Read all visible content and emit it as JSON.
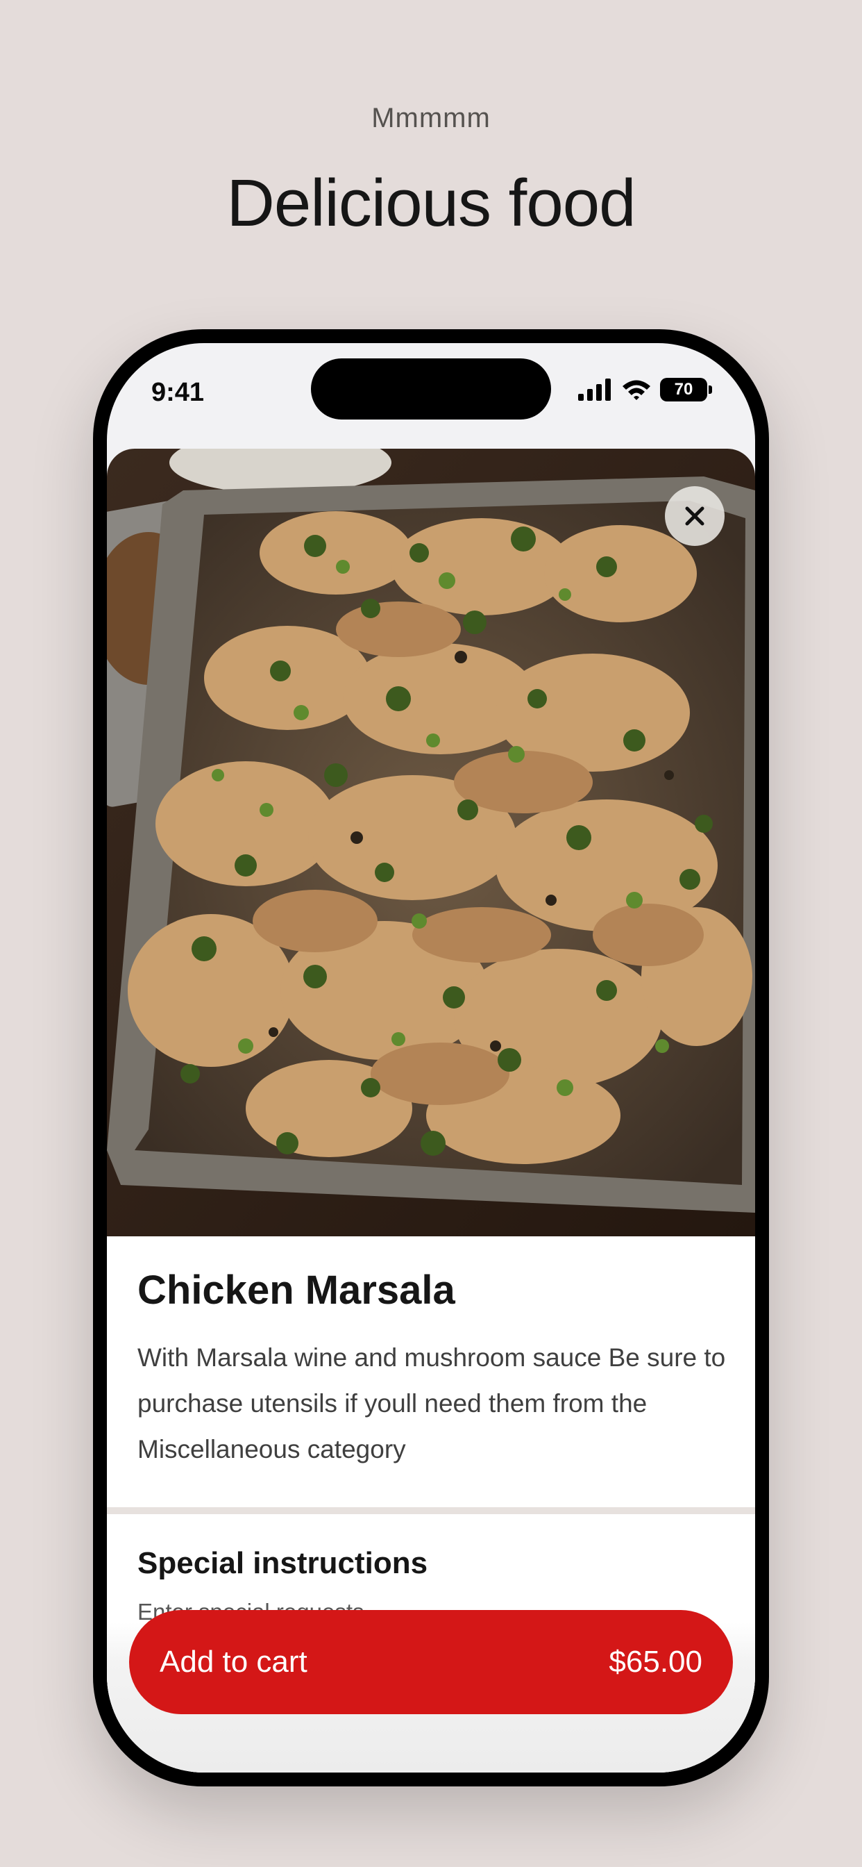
{
  "header": {
    "eyebrow": "Mmmmm",
    "title": "Delicious food"
  },
  "status_bar": {
    "time": "9:41",
    "battery": "70",
    "icons": [
      "cellular-signal-icon",
      "wifi-icon",
      "battery-icon"
    ]
  },
  "product": {
    "image_alt": "food-photo",
    "title": "Chicken Marsala",
    "description": "With Marsala wine and mushroom sauce Be sure to purchase utensils if youll need them from the Miscellaneous category"
  },
  "special_instructions": {
    "label": "Special instructions",
    "placeholder": "Enter special requests"
  },
  "cart": {
    "label": "Add to cart",
    "price": "$65.00"
  },
  "colors": {
    "background": "#e4dcda",
    "accent": "#d41717"
  }
}
